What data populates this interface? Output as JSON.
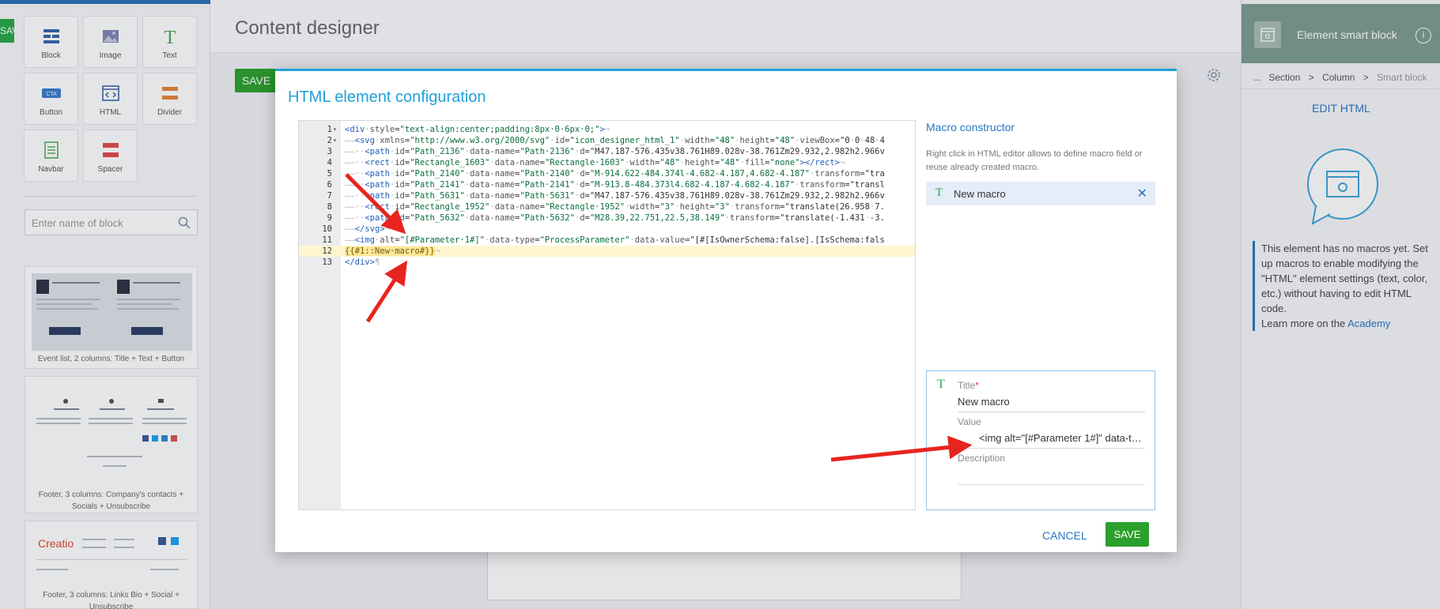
{
  "app": {
    "page_title": "Content designer",
    "save_label": "SAVE",
    "cut_save_label": "SAVE"
  },
  "palette": {
    "tiles": [
      {
        "label": "Block",
        "icon": "block-icon"
      },
      {
        "label": "Image",
        "icon": "image-icon"
      },
      {
        "label": "Text",
        "icon": "text-icon"
      },
      {
        "label": "Button",
        "icon": "button-icon"
      },
      {
        "label": "HTML",
        "icon": "html-icon"
      },
      {
        "label": "Divider",
        "icon": "divider-icon"
      },
      {
        "label": "Navbar",
        "icon": "navbar-icon"
      },
      {
        "label": "Spacer",
        "icon": "spacer-icon"
      }
    ],
    "search_placeholder": "Enter name of block",
    "templates": [
      {
        "caption": "Event list, 2 columns: Title + Text + Button"
      },
      {
        "caption": "Footer, 3 columns: Company's contacts + Socials + Unsubscribe"
      },
      {
        "caption": "Footer, 3 columns: Links Bio + Social + Unsubscribe"
      }
    ],
    "thumb_logo": "Creatio"
  },
  "modal": {
    "title": "HTML element configuration",
    "code_lines": [
      "<div·style=\"text-align:center;padding:8px·0·6px·0;\">¬",
      "——<svg·xmlns=\"http://www.w3.org/2000/svg\"·id=\"icon_designer_html_1\"·width=\"48\"·height=\"48\"·viewBox=\"0·0·48·4",
      "——··<path·id=\"Path_2136\"·data-name=\"Path·2136\"·d=\"M47.187-576.435v38.761H89.028v-38.761Zm29.932,2.982h2.966v",
      "——··<rect·id=\"Rectangle_1603\"·data-name=\"Rectangle·1603\"·width=\"48\"·height=\"48\"·fill=\"none\"></rect>¬",
      "——··<path·id=\"Path_2140\"·data-name=\"Path·2140\"·d=\"M-914.622-484.374l-4.682-4.187,4.682-4.187\"·transform=\"tra",
      "——··<path·id=\"Path_2141\"·data-name=\"Path·2141\"·d=\"M-913.8-484.373l4.682-4.187-4.682-4.187\"·transform=\"transl",
      "——··<path·id=\"Path_5631\"·data-name=\"Path·5631\"·d=\"M47.187-576.435v38.761H89.028v-38.761Zm29.932,2.982h2.966v",
      "——··<rect·id=\"Rectangle_1952\"·data-name=\"Rectangle·1952\"·width=\"3\"·height=\"3\"·transform=\"translate(26.958·7.",
      "——··<path·id=\"Path_5632\"·data-name=\"Path·5632\"·d=\"M28.39,22.751,22.5,38.149\"·transform=\"translate(-1.431·-3.",
      "——</svg>¬",
      "——<img·alt=\"[#Parameter·1#]\"·data-type=\"ProcessParameter\"·data-value=\"[#[IsOwnerSchema:false].[IsSchema:fals",
      "{{#1::New·macro#}}¬",
      "</div>¶"
    ],
    "macro_constructor_title": "Macro constructor",
    "macro_constructor_desc": "Right click in HTML editor allows to define macro field or reuse already created macro.",
    "macro_item_label": "New macro",
    "form": {
      "title_label": "Title",
      "title_value": "New macro",
      "value_label": "Value",
      "value_value": "<img alt=\"[#Parameter 1#]\" data-type=\"ProcessParameter\" data-value",
      "description_label": "Description",
      "description_value": ""
    },
    "cancel_label": "CANCEL",
    "save_label": "SAVE"
  },
  "right_panel": {
    "title": "Element smart block",
    "breadcrumb": [
      "...",
      "Section",
      "Column",
      "Smart block"
    ],
    "edit_html_label": "EDIT HTML",
    "no_macros_text": "This element has no macros yet. Set up macros to enable modifying the \"HTML\" element settings (text, color, etc.) without having to edit HTML code.",
    "learn_more_prefix": "Learn more on the",
    "academy_link": "Academy"
  },
  "colors": {
    "accent_blue": "#21a0d8",
    "save_green": "#2ca02c",
    "arrow_red": "#e8241f"
  }
}
